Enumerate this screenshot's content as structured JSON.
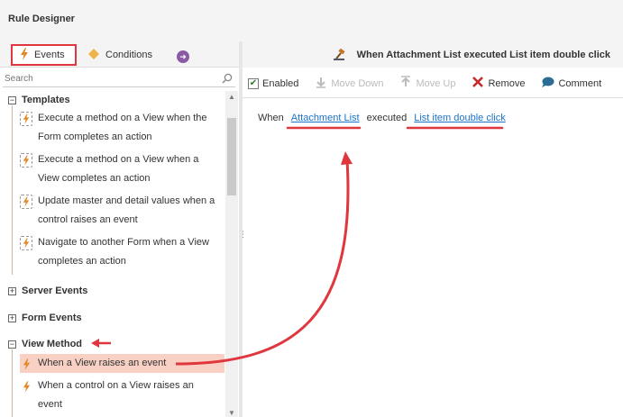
{
  "app": {
    "title": "Rule Designer"
  },
  "left_tabs": {
    "events_label": "Events",
    "conditions_label": "Conditions"
  },
  "search": {
    "placeholder": "Search"
  },
  "tree": {
    "templates": {
      "label": "Templates",
      "items": [
        {
          "line1": "Execute a method on a View when the",
          "line2": "Form completes an action"
        },
        {
          "line1": "Execute a method on a View when a",
          "line2": "View completes an action"
        },
        {
          "line1": "Update master and detail values when a",
          "line2": "control raises an event"
        },
        {
          "line1": "Navigate to another Form when a View",
          "line2": "completes an action"
        }
      ]
    },
    "server_events": {
      "label": "Server Events"
    },
    "form_events": {
      "label": "Form Events"
    },
    "view_method": {
      "label": "View Method",
      "items": [
        {
          "label": "When a View raises an event"
        },
        {
          "line1": "When a control on a View raises an",
          "line2": "event"
        }
      ]
    }
  },
  "right_header": {
    "title": "When Attachment List executed List item double click"
  },
  "toolbar": {
    "enabled_label": "Enabled",
    "move_down_label": "Move Down",
    "move_up_label": "Move Up",
    "remove_label": "Remove",
    "comment_label": "Comment"
  },
  "rule": {
    "prefix": "When",
    "view_link": "Attachment List",
    "middle": "executed",
    "event_link": "List item double click"
  },
  "colors": {
    "accent_red": "#e0373e",
    "link_blue": "#1a73c8",
    "bolt_orange": "#e08a2c",
    "selected_row": "#f8d1c4"
  }
}
